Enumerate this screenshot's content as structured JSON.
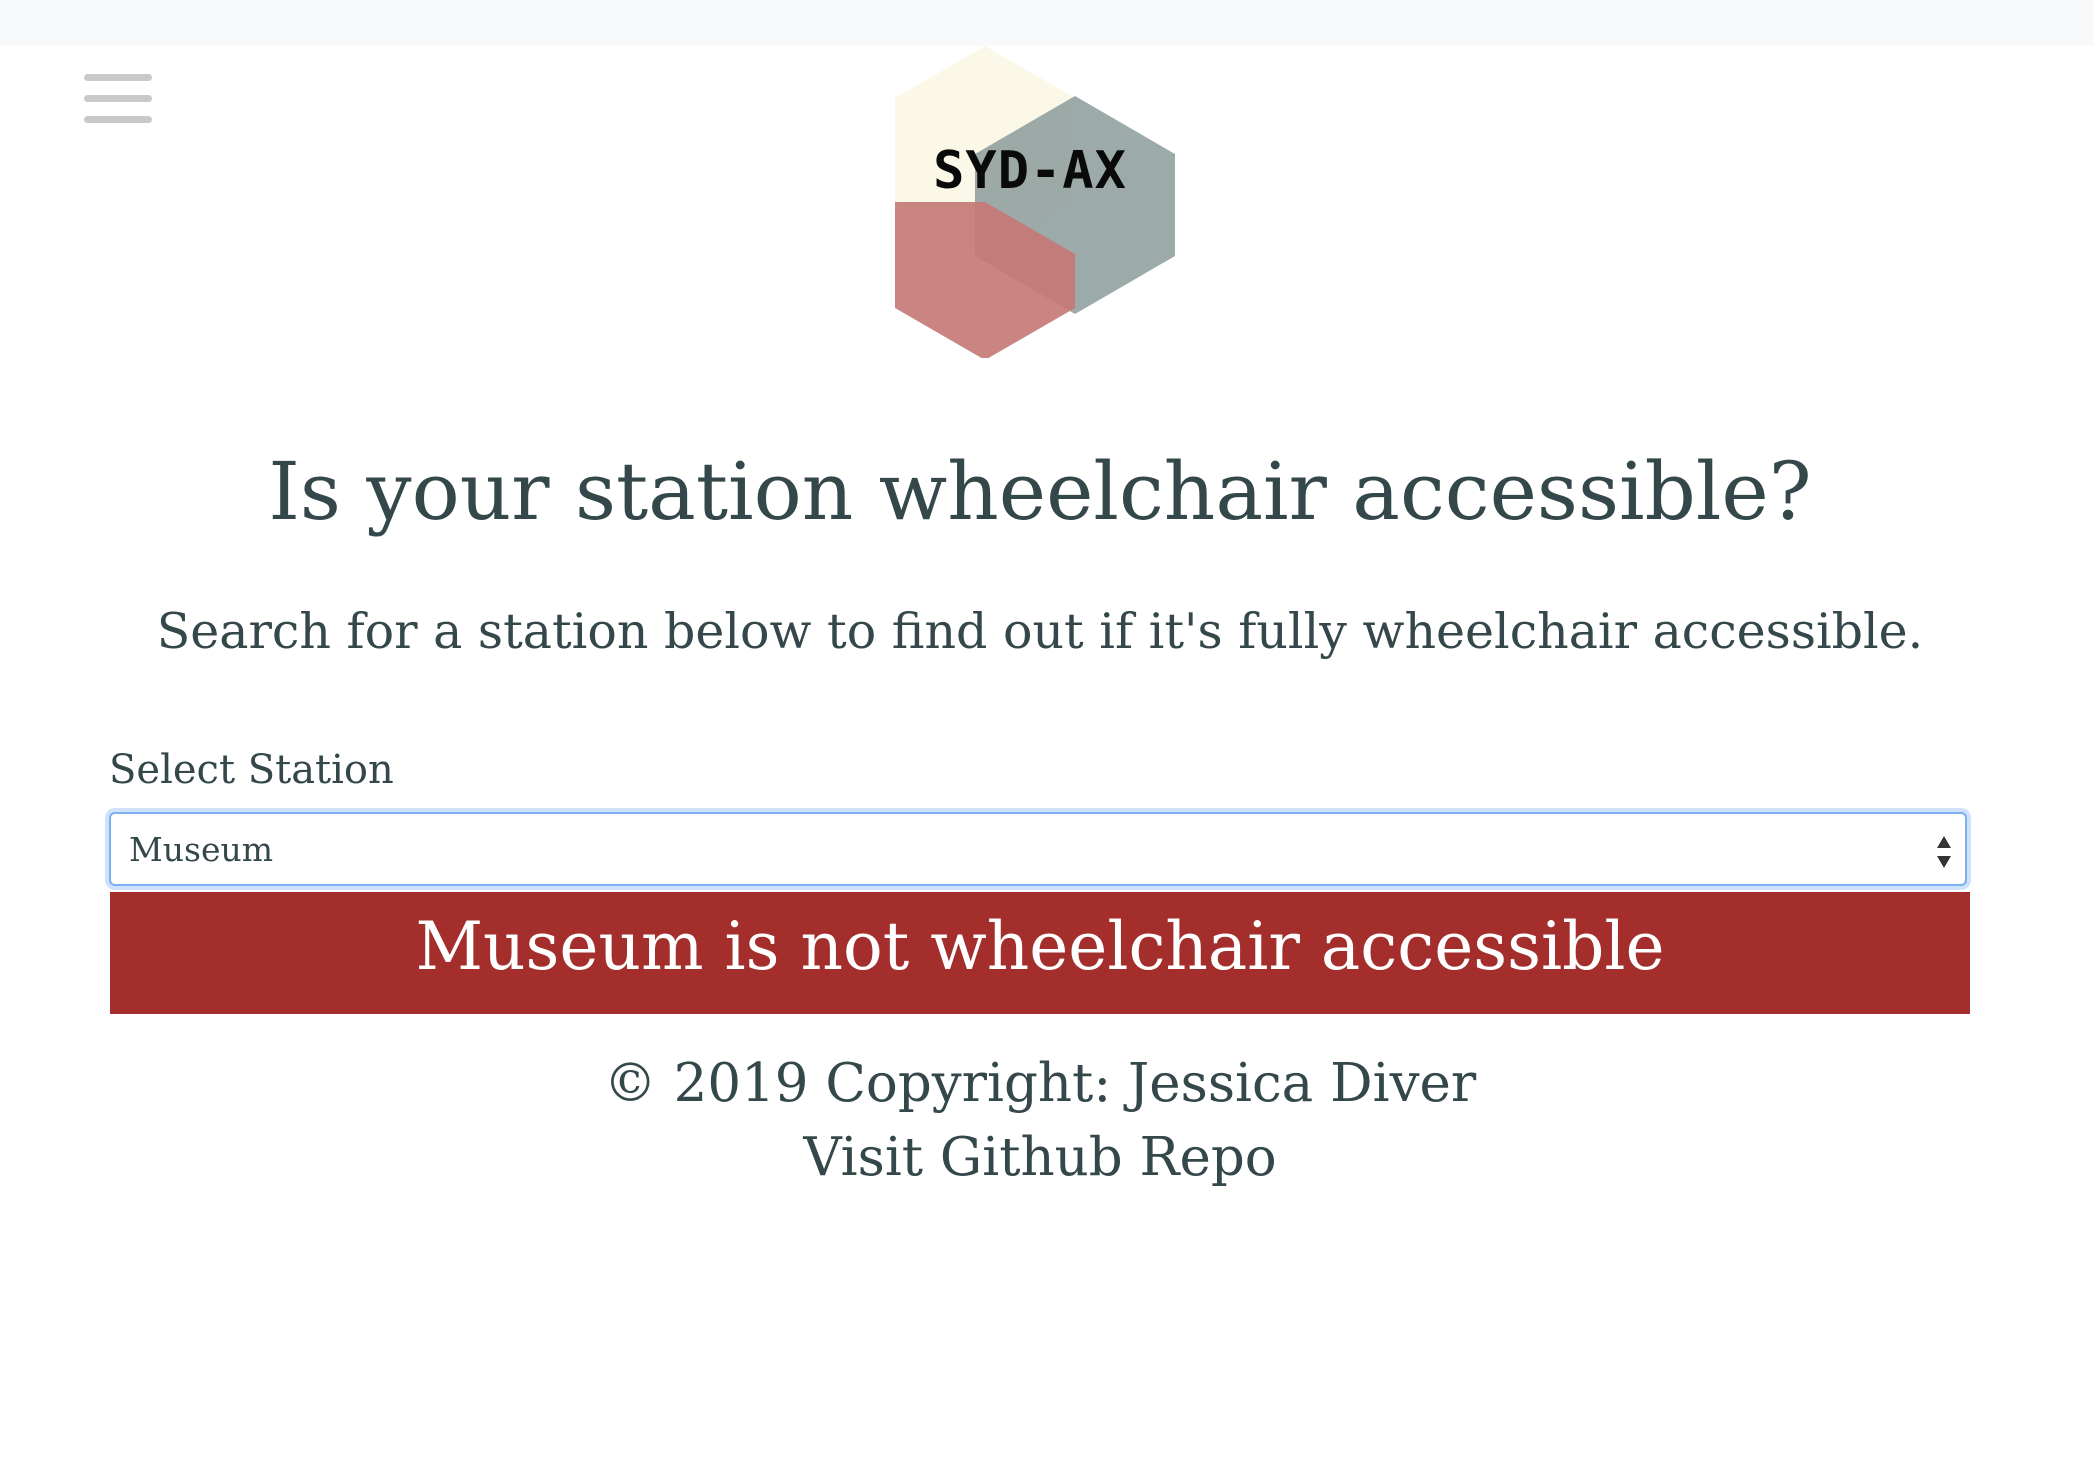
{
  "logo": {
    "text": "SYD-AX"
  },
  "nav": {
    "menu_icon": "hamburger-menu-icon"
  },
  "main": {
    "headline": "Is your station wheelchair accessible?",
    "subtitle": "Search for a station below to find out if it's fully wheelchair accessible.",
    "select_label": "Select Station",
    "selected_station": "Museum",
    "result_text": "Museum is not wheelchair accessible",
    "result_color": "#a32e2b"
  },
  "footer": {
    "copyright": "© 2019 Copyright: Jessica Diver",
    "repo_link": "Visit Github Repo"
  }
}
